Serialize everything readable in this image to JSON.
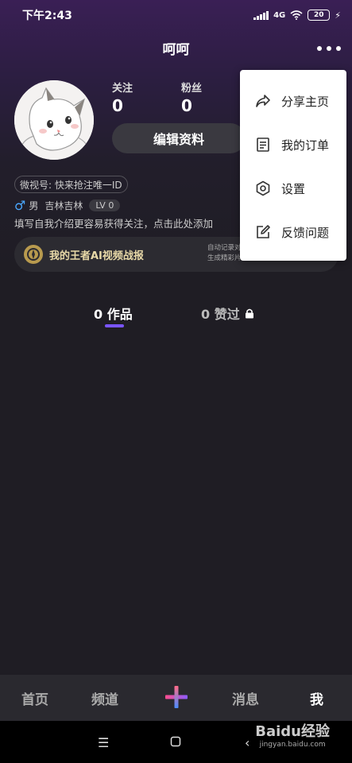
{
  "status_bar": {
    "time": "下午2:43",
    "network": "4G",
    "battery": "20"
  },
  "header": {
    "title": "呵呵"
  },
  "profile": {
    "following_label": "关注",
    "following_count": "0",
    "fans_label": "粉丝",
    "fans_count": "0",
    "edit_label": "编辑资料",
    "wechat_id": "微视号: 快来抢注唯一ID",
    "gender": "男",
    "location": "吉林吉林",
    "level": "LV 0",
    "bio": "填写自我介绍更容易获得关注，点击此处添加"
  },
  "battle_report": {
    "title": "我的王者AI视频战报",
    "sub_line1": "自动记录对",
    "sub_line2": "生成精彩片段集锦"
  },
  "tabs": {
    "works": "0 作品",
    "liked": "0 赞过"
  },
  "menu": {
    "items": [
      {
        "label": "分享主页",
        "icon": "share-icon"
      },
      {
        "label": "我的订单",
        "icon": "order-icon"
      },
      {
        "label": "设置",
        "icon": "settings-icon"
      },
      {
        "label": "反馈问题",
        "icon": "feedback-icon"
      }
    ]
  },
  "bottom_nav": {
    "home": "首页",
    "channel": "频道",
    "messages": "消息",
    "me": "我"
  },
  "watermark": {
    "brand": "Baidu经验",
    "url": "jingyan.baidu.com"
  },
  "colors": {
    "accent": "#7a55ff",
    "background": "#1f1d24",
    "male": "#4aa8ff"
  }
}
